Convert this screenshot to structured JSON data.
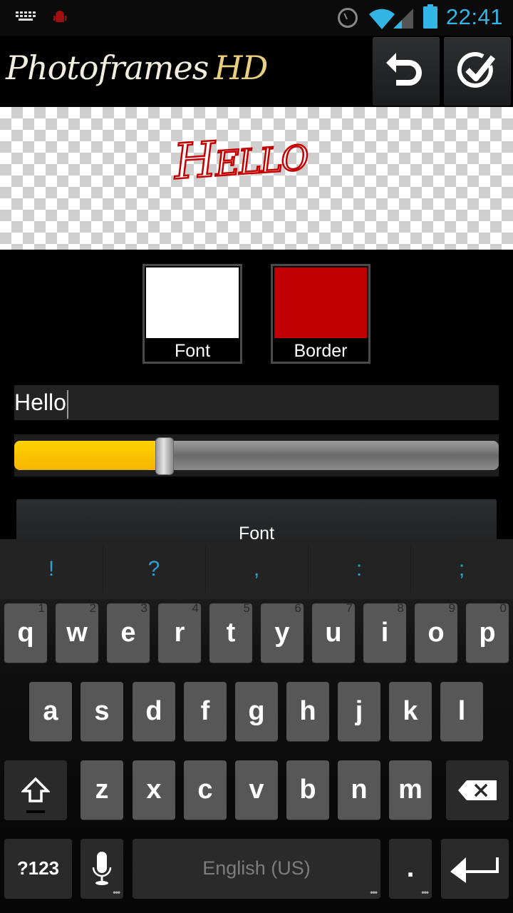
{
  "status_bar": {
    "time": "22:41",
    "icons": [
      "keyboard-icon",
      "android-debug-icon",
      "alarm-icon",
      "wifi-icon",
      "cell-signal-icon",
      "battery-icon"
    ],
    "accent_color": "#33b5e5"
  },
  "header": {
    "logo_main": "Photoframes",
    "logo_suffix": "HD",
    "buttons": [
      {
        "name": "undo",
        "icon": "undo-icon"
      },
      {
        "name": "confirm",
        "icon": "check-circle-icon"
      }
    ]
  },
  "preview": {
    "text": "Hello",
    "font_color": "#ffffff",
    "border_color": "#c40000"
  },
  "colors": {
    "font": {
      "label": "Font",
      "value": "#ffffff"
    },
    "border": {
      "label": "Border",
      "value": "#c00000"
    }
  },
  "text_input": {
    "value": "Hello"
  },
  "size_slider": {
    "value_fraction": 0.31,
    "fill_color": "#ffc400"
  },
  "font_button": {
    "label": "Font"
  },
  "keyboard": {
    "suggestions": [
      "!",
      "?",
      ",",
      ":",
      ";"
    ],
    "row1": [
      {
        "key": "q",
        "hint": "1"
      },
      {
        "key": "w",
        "hint": "2"
      },
      {
        "key": "e",
        "hint": "3"
      },
      {
        "key": "r",
        "hint": "4"
      },
      {
        "key": "t",
        "hint": "5"
      },
      {
        "key": "y",
        "hint": "6"
      },
      {
        "key": "u",
        "hint": "7"
      },
      {
        "key": "i",
        "hint": "8"
      },
      {
        "key": "o",
        "hint": "9"
      },
      {
        "key": "p",
        "hint": "0"
      }
    ],
    "row2": [
      "a",
      "s",
      "d",
      "f",
      "g",
      "h",
      "j",
      "k",
      "l"
    ],
    "row3": [
      "z",
      "x",
      "c",
      "v",
      "b",
      "n",
      "m"
    ],
    "symbols_label": "?123",
    "space_label": "English (US)",
    "period_label": "."
  }
}
